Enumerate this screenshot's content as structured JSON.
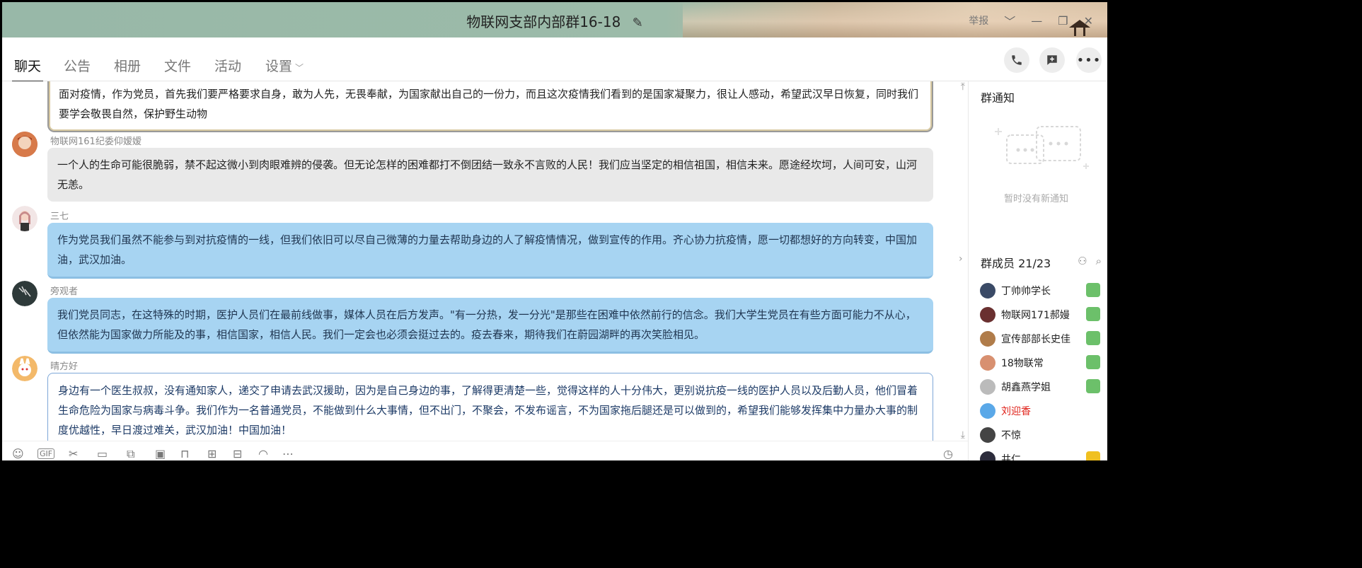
{
  "window": {
    "title": "物联网支部内部群16-18",
    "report_label": "举报"
  },
  "tabs": [
    {
      "label": "聊天",
      "active": true
    },
    {
      "label": "公告"
    },
    {
      "label": "相册"
    },
    {
      "label": "文件"
    },
    {
      "label": "活动"
    },
    {
      "label": "设置"
    }
  ],
  "messages": [
    {
      "sender": "",
      "style": "gold",
      "text": "面对疫情，作为党员，首先我们要严格要求自身，敢为人先，无畏奉献，为国家献出自己的一份力，而且这次疫情我们看到的是国家凝聚力，很让人感动，希望武汉早日恢复，同时我们要学会敬畏自然，保护野生动物"
    },
    {
      "sender": "物联网161纪委仰嫒嫒",
      "style": "gray",
      "text": "一个人的生命可能很脆弱，禁不起这微小到肉眼难辨的侵袭。但无论怎样的困难都打不倒团结一致永不言败的人民！我们应当坚定的相信祖国，相信未来。愿途经坎坷，人间可安，山河无恙。"
    },
    {
      "sender": "三七",
      "style": "blue",
      "text": "作为党员我们虽然不能参与到对抗疫情的一线，但我们依旧可以尽自己微薄的力量去帮助身边的人了解疫情情况，做到宣传的作用。齐心协力抗疫情，愿一切都想好的方向转变，中国加油，武汉加油。"
    },
    {
      "sender": "旁观者",
      "style": "blue",
      "text": "我们党员同志，在这特殊的时期，医护人员们在最前线做事，媒体人员在后方发声。\"有一分热，发一分光\"是那些在困难中依然前行的信念。我们大学生党员在有些方面可能力不从心，但依然能为国家做力所能及的事，相信国家，相信人民。我们一定会也必须会挺过去的。疫去春来，期待我们在蔚园湖畔的再次笑脸相见。"
    },
    {
      "sender": "晴方好",
      "style": "white",
      "text": "身边有一个医生叔叔，没有通知家人，递交了申请去武汉援助，因为是自己身边的事，了解得更清楚一些，觉得这样的人十分伟大，更别说抗疫一线的医护人员以及后勤人员，他们冒着生命危险为国家与病毒斗争。我们作为一名普通党员，不能做到什么大事情，但不出门，不聚会，不发布谣言，不为国家拖后腿还是可以做到的，希望我们能够发挥集中力量办大事的制度优越性，早日渡过难关，武汉加油！中国加油！"
    }
  ],
  "right_panel": {
    "notice_title": "群通知",
    "notice_empty": "暂时没有新通知",
    "members_title": "群成员 21/23",
    "members": [
      {
        "name": "丁帅帅学长",
        "avatar_color": "#3a4a66",
        "badge_color": "#6cc06a",
        "red": false
      },
      {
        "name": "物联网171郝嫚",
        "avatar_color": "#6a3030",
        "badge_color": "#6cc06a",
        "red": false
      },
      {
        "name": "宣传部部长史佳",
        "avatar_color": "#b07c4a",
        "badge_color": "#6cc06a",
        "red": false
      },
      {
        "name": "18物联常",
        "avatar_color": "#d89070",
        "badge_color": "#6cc06a",
        "red": false
      },
      {
        "name": "胡鑫燕学姐",
        "avatar_color": "#bbbbbb",
        "badge_color": "#6cc06a",
        "red": false
      },
      {
        "name": "刘迎香",
        "avatar_color": "#5aa8e8",
        "badge_color": "",
        "red": true
      },
      {
        "name": "不惊",
        "avatar_color": "#444444",
        "badge_color": "",
        "red": false
      },
      {
        "name": "井仁",
        "avatar_color": "#2c2c3c",
        "badge_color": "#f0c020",
        "red": false
      }
    ]
  },
  "icons": {
    "edit": "pencil-icon",
    "call": "phone-icon",
    "new_chat": "add-chat-icon",
    "more": "more-icon"
  }
}
